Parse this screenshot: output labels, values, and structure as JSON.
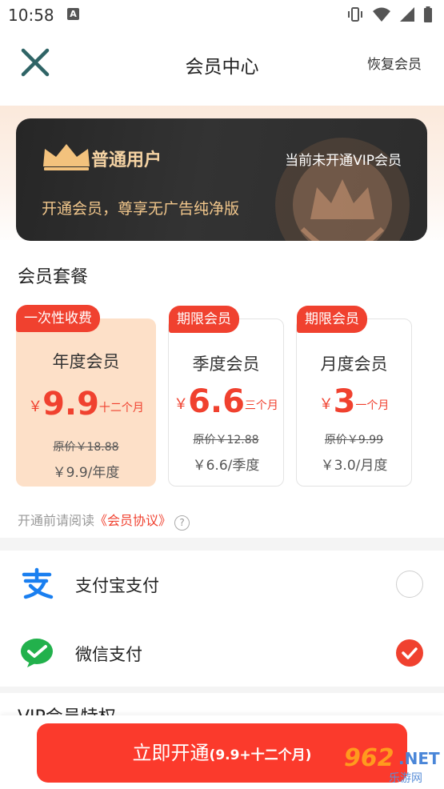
{
  "status_bar": {
    "time": "10:58",
    "notification_icon": "A"
  },
  "header": {
    "title": "会员中心",
    "restore_label": "恢复会员"
  },
  "vip_card": {
    "level": "普通用户",
    "status": "当前未开通VIP会员",
    "desc": "开通会员，尊享无广告纯净版"
  },
  "plans_section": {
    "title": "会员套餐"
  },
  "plans": [
    {
      "badge": "一次性收费",
      "name": "年度会员",
      "currency": "￥",
      "price": "9.9",
      "unit": "十二个月",
      "original": "原价￥18.88",
      "avg": "￥9.9/年度",
      "selected": true
    },
    {
      "badge": "期限会员",
      "name": "季度会员",
      "currency": "￥",
      "price": "6.6",
      "unit": "三个月",
      "original": "原价￥12.88",
      "avg": "￥6.6/季度",
      "selected": false
    },
    {
      "badge": "期限会员",
      "name": "月度会员",
      "currency": "￥",
      "price": "3",
      "unit": "一个月",
      "original": "原价￥9.99",
      "avg": "￥3.0/月度",
      "selected": false
    }
  ],
  "agreement": {
    "prefix": "开通前请阅读",
    "link": "《会员协议》",
    "help": "?"
  },
  "payment": [
    {
      "label": "支付宝支付",
      "icon": "alipay-icon",
      "checked": false
    },
    {
      "label": "微信支付",
      "icon": "wechat-pay-icon",
      "checked": true
    }
  ],
  "features": {
    "title": "VIP会员特权"
  },
  "cta": {
    "main": "立即开通",
    "sub": "(9.9+十二个月)"
  },
  "watermark": {
    "number": "962",
    "suffix": ".NET",
    "sub": "乐游网"
  },
  "colors": {
    "accent": "#f0412f",
    "cta": "#fb3a2c",
    "gold": "#f5d3a3",
    "card_dark": "#2a2a2a",
    "selected_plan": "#fde0c8"
  }
}
